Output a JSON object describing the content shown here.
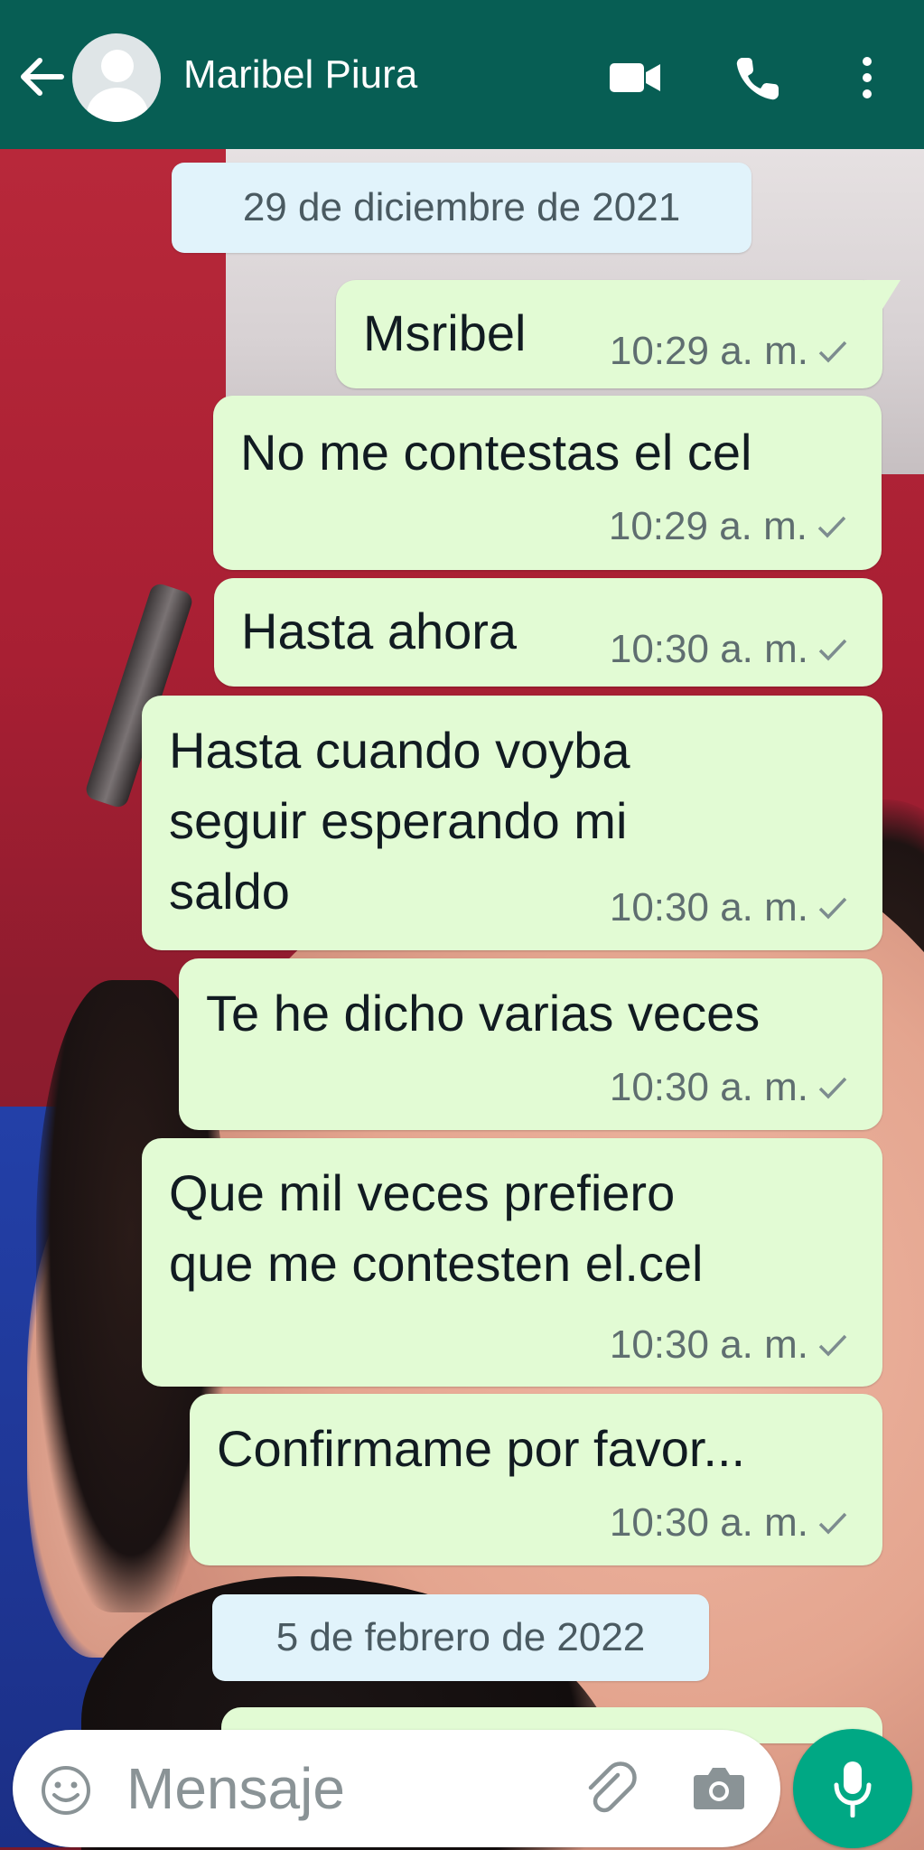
{
  "header": {
    "contact_name": "Maribel Piura",
    "icons": [
      "back-arrow-icon",
      "avatar",
      "video-call-icon",
      "phone-icon",
      "more-vert-icon"
    ],
    "color": "#075e54"
  },
  "dates": [
    "29 de diciembre de 2021",
    "5 de febrero de 2022"
  ],
  "messages": [
    {
      "text": "Msribel",
      "time": "10:29 a. m.",
      "status": "sent"
    },
    {
      "text": "No me contestas el cel",
      "time": "10:29 a. m.",
      "status": "sent"
    },
    {
      "text": "Hasta ahora",
      "time": "10:30 a. m.",
      "status": "sent"
    },
    {
      "lines": [
        "Hasta cuando voyba",
        "seguir esperando mi",
        "saldo"
      ],
      "time": "10:30 a. m.",
      "status": "sent"
    },
    {
      "text": "Te he dicho varias veces",
      "time": "10:30 a. m.",
      "status": "sent"
    },
    {
      "lines": [
        "Que mil veces prefiero",
        "que me contesten el.cel"
      ],
      "time": "10:30 a. m.",
      "status": "sent"
    },
    {
      "text": "Confirmame por favor...",
      "time": "10:30 a. m.",
      "status": "sent"
    }
  ],
  "composer": {
    "placeholder": "Mensaje",
    "icons": [
      "emoji-icon",
      "attach-icon",
      "camera-icon",
      "mic-icon"
    ],
    "mic_color": "#00a884"
  },
  "colors": {
    "bubble_out": "#e2fbd4",
    "date_chip": "#e1f3fb"
  }
}
